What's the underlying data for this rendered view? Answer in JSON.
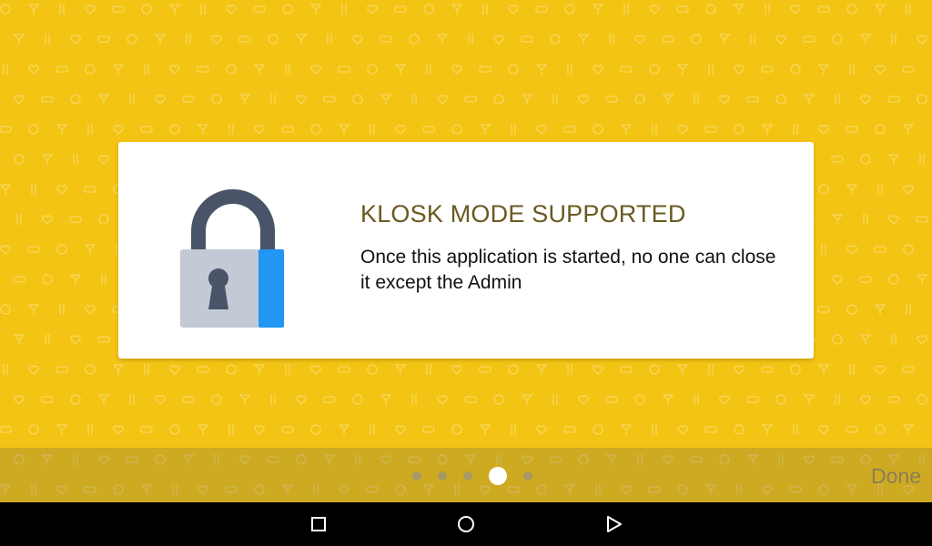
{
  "slide": {
    "title": "KLOSK MODE SUPPORTED",
    "body": "Once this application is started, no one can close it except the Admin",
    "icon": "padlock-icon"
  },
  "pager": {
    "total": 5,
    "active_index": 3
  },
  "footer": {
    "done_label": "Done"
  },
  "nav_bar": {
    "buttons": [
      "recent-apps-icon",
      "home-icon",
      "back-icon"
    ]
  },
  "colors": {
    "background": "#F4C414",
    "title": "#6A5A20",
    "lock_shackle": "#4A5468",
    "lock_body": "#C3CAD6",
    "lock_side": "#2196F3"
  }
}
